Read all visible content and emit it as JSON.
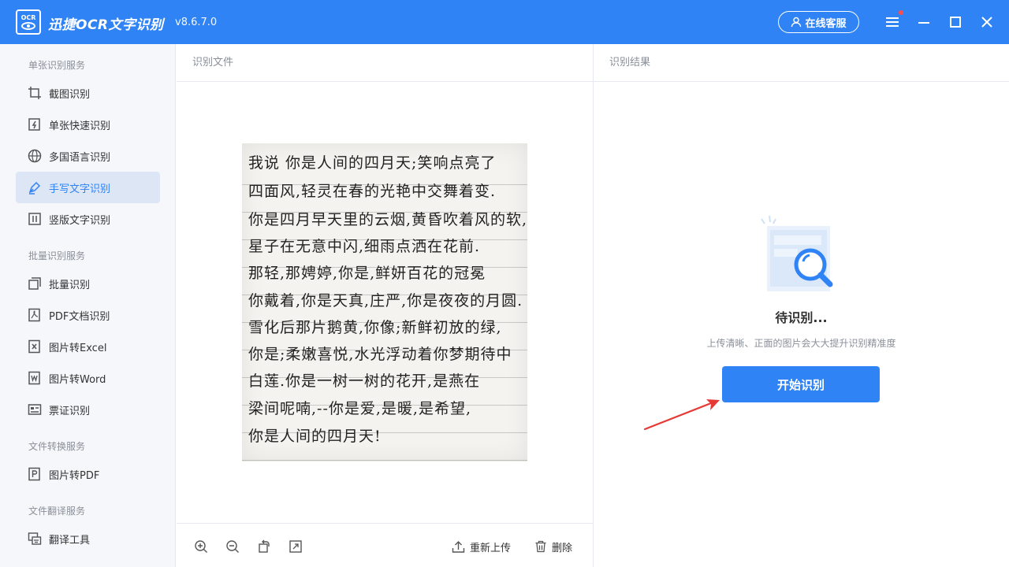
{
  "app": {
    "logo_text": "OCR",
    "title": "迅捷OCR文字识别",
    "version": "v8.6.7.0",
    "support_label": "在线客服"
  },
  "sidebar": {
    "sections": [
      {
        "title": "单张识别服务"
      },
      {
        "title": "批量识别服务"
      },
      {
        "title": "文件转换服务"
      },
      {
        "title": "文件翻译服务"
      }
    ],
    "items": [
      {
        "label": "截图识别",
        "icon": "crop-icon"
      },
      {
        "label": "单张快速识别",
        "icon": "quick-scan-icon"
      },
      {
        "label": "多国语言识别",
        "icon": "globe-icon"
      },
      {
        "label": "手写文字识别",
        "icon": "pen-icon",
        "active": true
      },
      {
        "label": "竖版文字识别",
        "icon": "vertical-text-icon"
      },
      {
        "label": "批量识别",
        "icon": "batch-icon"
      },
      {
        "label": "PDF文档识别",
        "icon": "pdf-icon"
      },
      {
        "label": "图片转Excel",
        "icon": "excel-icon"
      },
      {
        "label": "图片转Word",
        "icon": "word-icon"
      },
      {
        "label": "票证识别",
        "icon": "ticket-icon"
      },
      {
        "label": "图片转PDF",
        "icon": "image-to-pdf-icon"
      },
      {
        "label": "翻译工具",
        "icon": "translate-icon"
      }
    ]
  },
  "file_panel": {
    "title": "识别文件",
    "document_lines": [
      "我说  你是人间的四月天;笑响点亮了",
      "四面风,轻灵在春的光艳中交舞着变.",
      "你是四月早天里的云烟,黄昏吹着风的软,",
      "星子在无意中闪,细雨点洒在花前.",
      "那轻,那娉婷,你是,鲜妍百花的冠冕",
      "你戴着,你是天真,庄严,你是夜夜的月圆.",
      "雪化后那片鹅黄,你像;新鲜初放的绿,",
      "你是;柔嫩喜悦,水光浮动着你梦期待中",
      "白莲.你是一树一树的花开,是燕在",
      "梁间呢喃,--你是爱,是暖,是希望,",
      "你是人间的四月天!"
    ],
    "reupload_label": "重新上传",
    "delete_label": "删除"
  },
  "result_panel": {
    "title": "识别结果",
    "status": "待识别...",
    "hint": "上传清晰、正面的图片会大大提升识别精准度",
    "start_label": "开始识别"
  },
  "colors": {
    "brand": "#2f83f5",
    "arrow": "#e53935"
  }
}
